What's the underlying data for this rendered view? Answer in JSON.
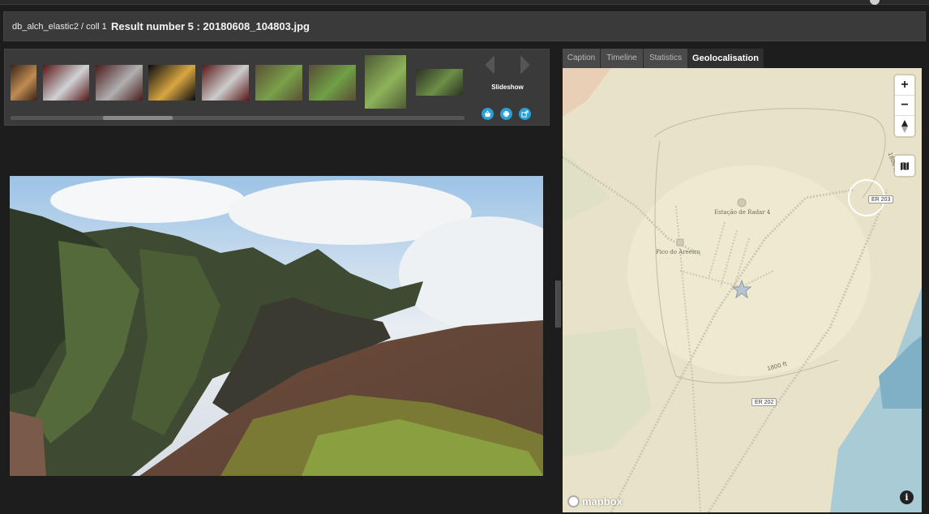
{
  "header": {
    "db_path": "db_alch_elastic2 / coll 1",
    "result_title": "Result number 5 : 20180608_104803.jpg"
  },
  "thumbnails": {
    "slideshow_label": "Slideshow",
    "items": [
      {
        "name": "thumb-interior-1",
        "c1": "#3b2417",
        "c2": "#c08b52"
      },
      {
        "name": "thumb-interior-2",
        "c1": "#5a1414",
        "c2": "#cfd2d6"
      },
      {
        "name": "thumb-interior-3",
        "c1": "#4a1a1a",
        "c2": "#b0b0b0"
      },
      {
        "name": "thumb-night",
        "c1": "#0a0c12",
        "c2": "#d9a640"
      },
      {
        "name": "thumb-interior-4",
        "c1": "#5a1616",
        "c2": "#cccccc"
      },
      {
        "name": "thumb-plant-1",
        "c1": "#5a5035",
        "c2": "#7aa04a"
      },
      {
        "name": "thumb-plant-2",
        "c1": "#5b4c36",
        "c2": "#6fa045"
      },
      {
        "name": "thumb-plant-3",
        "c1": "#4f5a36",
        "c2": "#8db35a"
      },
      {
        "name": "thumb-object",
        "c1": "#2c3124",
        "c2": "#6d8f47"
      }
    ]
  },
  "tabs": [
    {
      "label": "Caption",
      "active": false
    },
    {
      "label": "Timeline",
      "active": false
    },
    {
      "label": "Statistics",
      "active": false
    },
    {
      "label": "Geolocalisation",
      "active": true
    }
  ],
  "map": {
    "labels": {
      "radar": "Estação de Radar 4",
      "pico": "Pico do Areeiro",
      "contour1": "1800 ft",
      "contour2": "1800 ft"
    },
    "shields": {
      "er203": "ER 203",
      "er202": "ER 202"
    },
    "logo": "mapbox",
    "zoom_in": "+",
    "zoom_out": "−",
    "info": "i"
  },
  "colors": {
    "accent_blue": "#2a9fd6",
    "map_land": "#e8e2c8",
    "map_water": "#a9cbd6"
  }
}
